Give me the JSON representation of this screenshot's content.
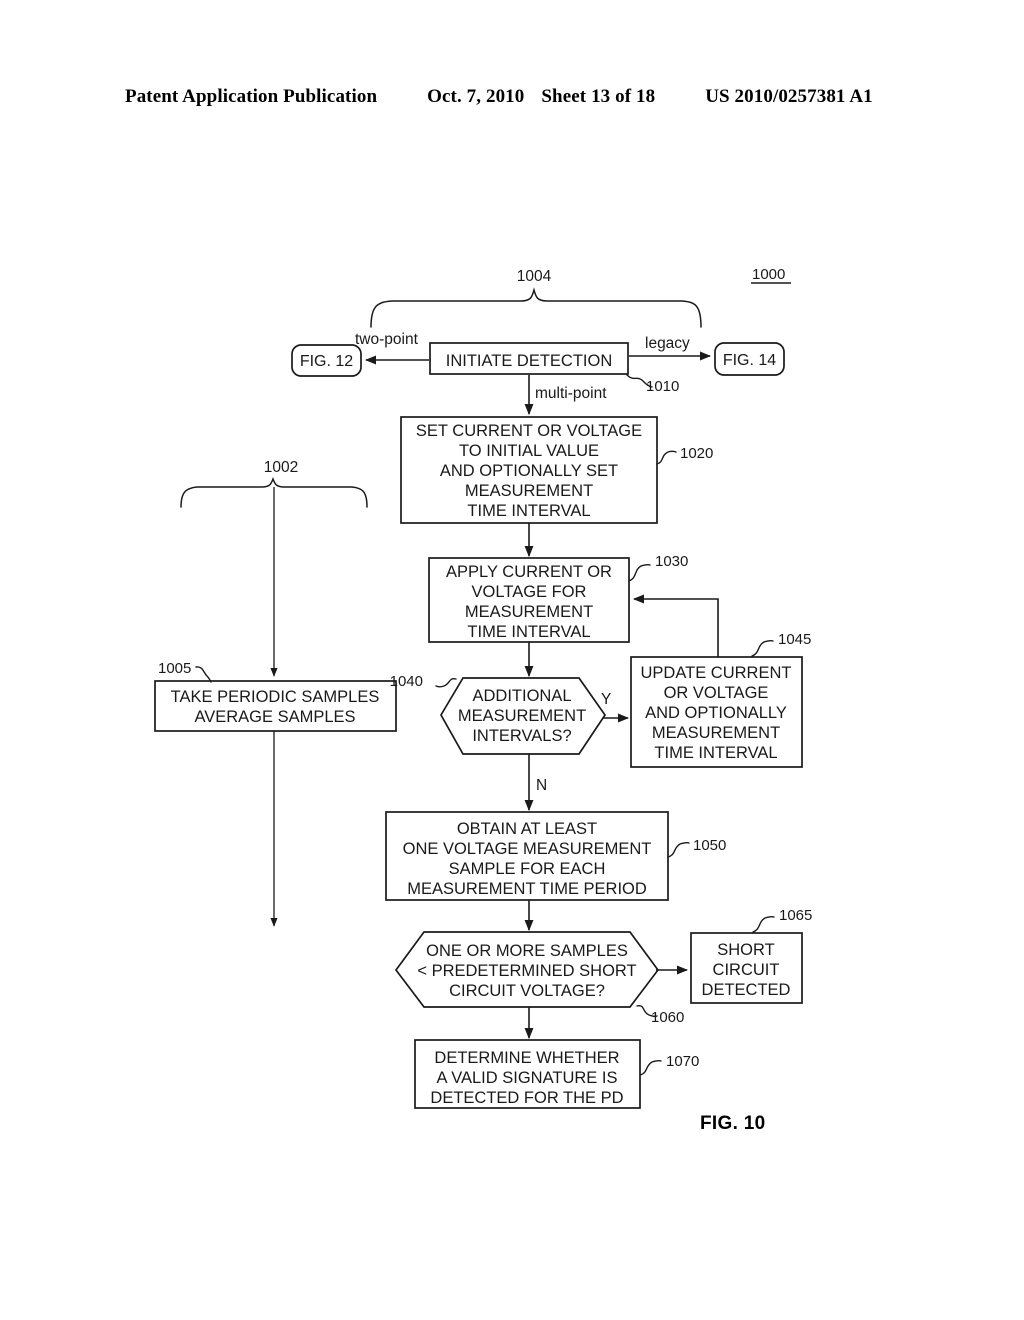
{
  "header": {
    "publication": "Patent Application Publication",
    "date": "Oct. 7, 2010",
    "sheet": "Sheet 13 of 18",
    "patent_number": "US 2010/0257381 A1"
  },
  "figure": {
    "caption": "FIG. 10",
    "diagram_label": "1000"
  },
  "refs": {
    "r1000": "1000",
    "r1002": "1002",
    "r1004": "1004",
    "r1005": "1005",
    "r1010": "1010",
    "r1020": "1020",
    "r1030": "1030",
    "r1040": "1040",
    "r1045": "1045",
    "r1050": "1050",
    "r1060": "1060",
    "r1065": "1065",
    "r1070": "1070"
  },
  "nodes": {
    "fig12": {
      "label": "FIG. 12"
    },
    "fig14": {
      "label": "FIG. 14"
    },
    "initiate": {
      "lines": [
        "INITIATE DETECTION"
      ]
    },
    "set_value": {
      "lines": [
        "SET CURRENT OR VOLTAGE",
        "TO INITIAL VALUE",
        "AND OPTIONALLY SET",
        "MEASUREMENT",
        "TIME INTERVAL"
      ]
    },
    "apply": {
      "lines": [
        "APPLY CURRENT OR",
        "VOLTAGE FOR",
        "MEASUREMENT",
        "TIME INTERVAL"
      ]
    },
    "additional": {
      "lines": [
        "ADDITIONAL",
        "MEASUREMENT",
        "INTERVALS?"
      ]
    },
    "update": {
      "lines": [
        "UPDATE CURRENT",
        "OR VOLTAGE",
        "AND OPTIONALLY",
        "MEASUREMENT",
        "TIME INTERVAL"
      ]
    },
    "samples": {
      "lines": [
        "TAKE PERIODIC SAMPLES",
        "AVERAGE SAMPLES"
      ]
    },
    "obtain": {
      "lines": [
        "OBTAIN AT LEAST",
        "ONE VOLTAGE MEASUREMENT",
        "SAMPLE FOR EACH",
        "MEASUREMENT TIME PERIOD"
      ]
    },
    "short_test": {
      "lines": [
        "ONE OR MORE SAMPLES",
        "< PREDETERMINED SHORT",
        "CIRCUIT VOLTAGE?"
      ]
    },
    "short_detected": {
      "lines": [
        "SHORT",
        "CIRCUIT",
        "DETECTED"
      ]
    },
    "determine": {
      "lines": [
        "DETERMINE WHETHER",
        "A VALID SIGNATURE IS",
        "DETECTED FOR THE PD"
      ]
    }
  },
  "edges": {
    "two_point": "two-point",
    "legacy": "legacy",
    "multi_point": "multi-point",
    "yes": "Y",
    "no": "N"
  },
  "colors": {
    "ink": "#1a1a1a",
    "paper": "#ffffff"
  }
}
